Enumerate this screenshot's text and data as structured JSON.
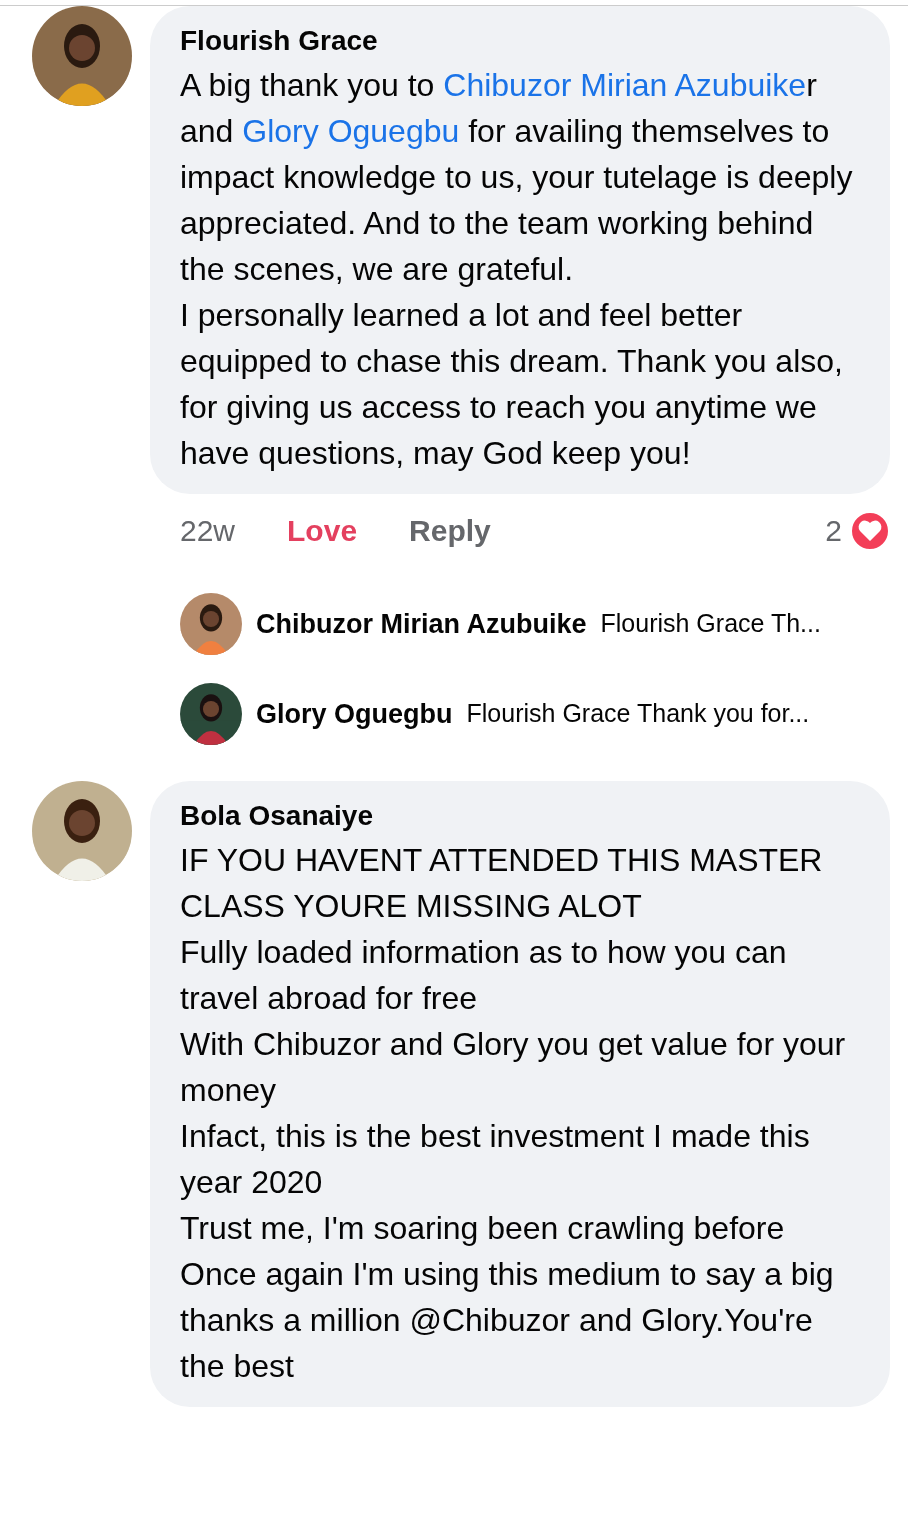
{
  "comments": [
    {
      "author": "Flourish Grace",
      "paragraphs": [
        [
          {
            "kind": "plain",
            "text": " A big thank you to "
          },
          {
            "kind": "mention",
            "text": "Chibuzor Mirian Azubuike"
          },
          {
            "kind": "plain",
            "text": "r and "
          },
          {
            "kind": "mention",
            "text": "Glory Oguegbu"
          },
          {
            "kind": "plain",
            "text": " for availing themselves to impact knowledge to us, your tutelage is deeply appreciated. And to the team working behind the scenes, we are grateful."
          }
        ],
        [
          {
            "kind": "plain",
            "text": "I personally learned a lot and feel better equipped to chase this dream. Thank you also, for giving us access to reach you anytime we have questions, may God keep you!"
          }
        ]
      ],
      "time": "22w",
      "reaction": {
        "label": "Love",
        "selected": true
      },
      "reply_label": "Reply",
      "reaction_count": "2",
      "replies": [
        {
          "author": "Chibuzor Mirian Azubuike",
          "snippet": "Flourish Grace Th..."
        },
        {
          "author": "Glory Oguegbu",
          "snippet": "Flourish Grace Thank you for..."
        }
      ]
    },
    {
      "author": "Bola Osanaiye",
      "paragraphs": [
        [
          {
            "kind": "plain",
            "text": "IF YOU HAVENT ATTENDED THIS MASTER CLASS YOURE MISSING ALOT"
          }
        ],
        [
          {
            "kind": "plain",
            "text": "Fully loaded information as to how you can travel abroad for free"
          }
        ],
        [
          {
            "kind": "plain",
            "text": "With Chibuzor and Glory you get value for your money"
          }
        ],
        [
          {
            "kind": "plain",
            "text": "Infact, this is the best investment I made this year 2020"
          }
        ],
        [
          {
            "kind": "plain",
            "text": "Trust me, I'm soaring been crawling before"
          }
        ],
        [
          {
            "kind": "plain",
            "text": "Once again I'm using this medium to say a big thanks a million @Chibuzor and Glory.You're the best"
          }
        ]
      ]
    }
  ]
}
